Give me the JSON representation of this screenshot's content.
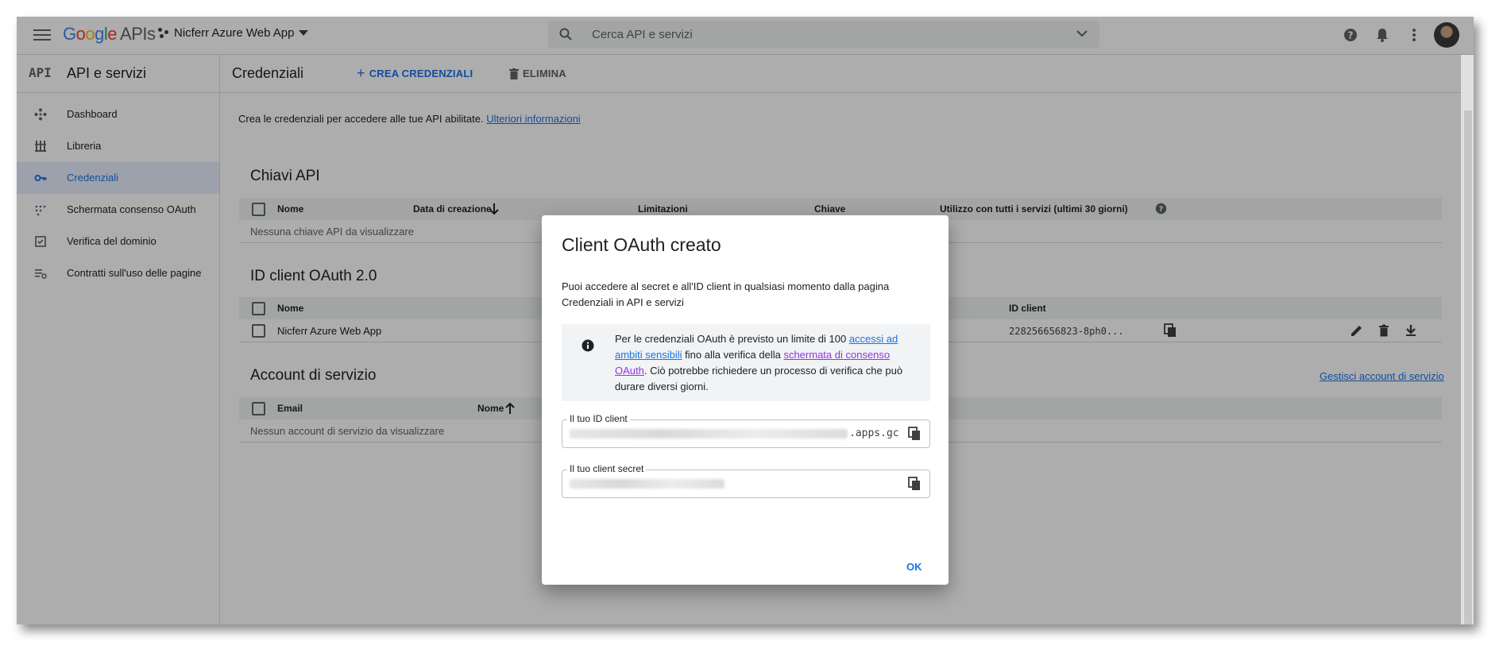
{
  "colors": {
    "accent": "#1a73e8",
    "text": "#202124",
    "muted": "#5f6368",
    "visited_link": "#9334e6"
  },
  "topbar": {
    "logo_google": "Google",
    "logo_apis": "APIs",
    "project_name": "Nicferr Azure Web App",
    "search_placeholder": "Cerca API e servizi",
    "icons": [
      "menu-icon",
      "search-icon",
      "chevron-down-icon",
      "help-icon",
      "notifications-icon",
      "more-vert-icon",
      "avatar"
    ]
  },
  "sidebar": {
    "badge": "API",
    "title": "API e servizi",
    "items": [
      {
        "label": "Dashboard",
        "icon": "dashboard-icon",
        "active": false
      },
      {
        "label": "Libreria",
        "icon": "library-icon",
        "active": false
      },
      {
        "label": "Credenziali",
        "icon": "key-icon",
        "active": true
      },
      {
        "label": "Schermata consenso OAuth",
        "icon": "consent-icon",
        "active": false
      },
      {
        "label": "Verifica del dominio",
        "icon": "domain-check-icon",
        "active": false
      },
      {
        "label": "Contratti sull'uso delle pagine",
        "icon": "settings-list-icon",
        "active": false
      }
    ]
  },
  "main": {
    "title": "Credenziali",
    "create_label": "CREA CREDENZIALI",
    "delete_label": "ELIMINA",
    "intro_text": "Crea le credenziali per accedere alle tue API abilitate.",
    "intro_link": "Ulteriori informazioni",
    "api_keys": {
      "title": "Chiavi API",
      "columns": [
        "Nome",
        "Data di creazione",
        "Limitazioni",
        "Chiave",
        "Utilizzo con tutti i servizi (ultimi 30 giorni)"
      ],
      "empty": "Nessuna chiave API da visualizzare"
    },
    "oauth": {
      "title": "ID client OAuth 2.0",
      "columns": [
        "Nome",
        "ID client"
      ],
      "rows": [
        {
          "name": "Nicferr Azure Web App",
          "client_id": "228256656823-8ph0..."
        }
      ]
    },
    "service_accounts": {
      "title": "Account di servizio",
      "manage_link": "Gestisci account di servizio",
      "columns": [
        "Email",
        "Nome"
      ],
      "empty": "Nessun account di servizio da visualizzare"
    }
  },
  "dialog": {
    "title": "Client OAuth creato",
    "body": "Puoi accedere al secret e all'ID client in qualsiasi momento dalla pagina Credenziali in API e servizi",
    "info": {
      "t1": "Per le credenziali OAuth è previsto un limite di 100 ",
      "l1": "accessi ad ambiti sensibili",
      "t2": " fino alla verifica della ",
      "l2": "schermata di consenso OAuth",
      "t3": ". Ciò potrebbe richiedere un processo di verifica che può durare diversi giorni."
    },
    "client_id_label": "Il tuo ID client",
    "client_id_suffix": ".apps.gc",
    "client_secret_label": "Il tuo client secret",
    "ok_label": "OK"
  }
}
